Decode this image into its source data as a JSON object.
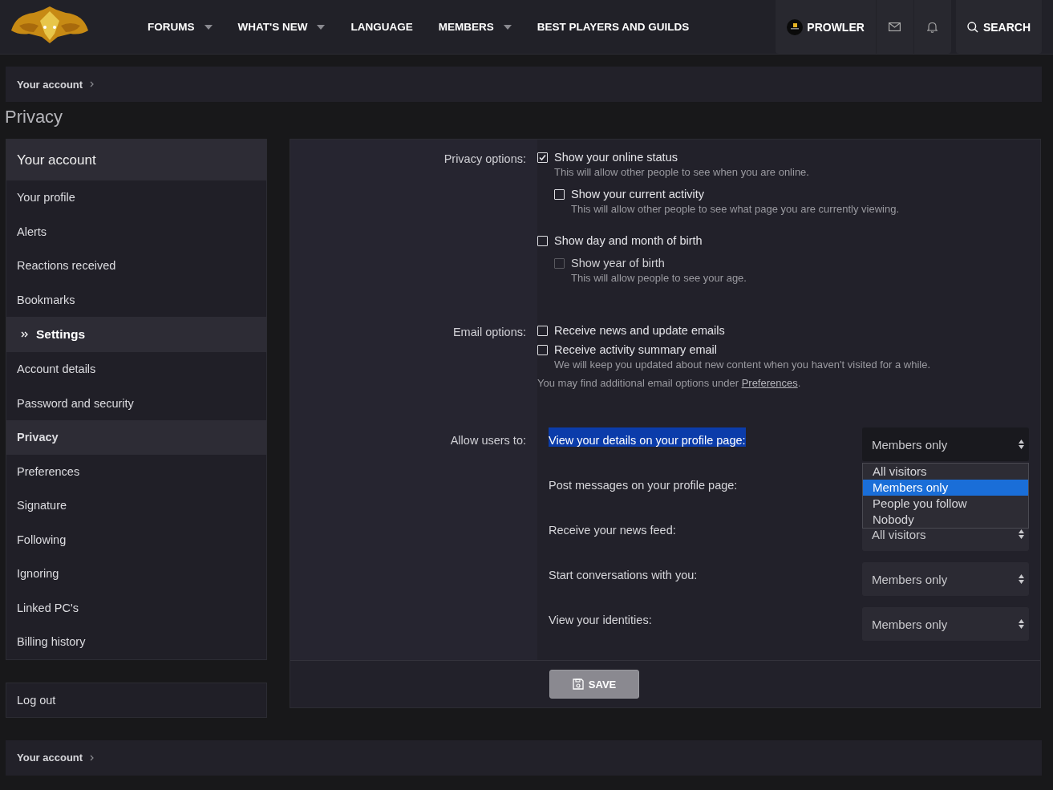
{
  "header": {
    "nav": [
      {
        "label": "FORUMS",
        "has_menu": true
      },
      {
        "label": "WHAT'S NEW",
        "has_menu": true
      },
      {
        "label": "LANGUAGE",
        "has_menu": false
      },
      {
        "label": "MEMBERS",
        "has_menu": true
      },
      {
        "label": "BEST PLAYERS AND GUILDS",
        "has_menu": false
      }
    ],
    "user": {
      "name": "PROWLER"
    },
    "search": {
      "label": "SEARCH"
    }
  },
  "breadcrumb_top": {
    "label": "Your account"
  },
  "page_title": "Privacy",
  "sidebar": {
    "heading": "Your account",
    "items": [
      {
        "label": "Your profile",
        "kind": "link",
        "selected": false
      },
      {
        "label": "Alerts",
        "kind": "link",
        "selected": false
      },
      {
        "label": "Reactions received",
        "kind": "link",
        "selected": false
      },
      {
        "label": "Bookmarks",
        "kind": "link",
        "selected": false
      },
      {
        "label": "Settings",
        "kind": "section",
        "selected": false
      },
      {
        "label": "Account details",
        "kind": "link",
        "selected": false
      },
      {
        "label": "Password and security",
        "kind": "link",
        "selected": false
      },
      {
        "label": "Privacy",
        "kind": "link",
        "selected": true
      },
      {
        "label": "Preferences",
        "kind": "link",
        "selected": false
      },
      {
        "label": "Signature",
        "kind": "link",
        "selected": false
      },
      {
        "label": "Following",
        "kind": "link",
        "selected": false
      },
      {
        "label": "Ignoring",
        "kind": "link",
        "selected": false
      },
      {
        "label": "Linked PC's",
        "kind": "link",
        "selected": false
      },
      {
        "label": "Billing history",
        "kind": "link",
        "selected": false
      }
    ],
    "logout": "Log out"
  },
  "form": {
    "groups": [
      {
        "label": "Privacy options:",
        "options": [
          {
            "label": "Show your online status",
            "checked": true,
            "disabled": false,
            "hint": "This will allow other people to see when you are online.",
            "children": [
              {
                "label": "Show your current activity",
                "checked": false,
                "disabled": false,
                "hint": "This will allow other people to see what page you are currently viewing."
              }
            ]
          },
          {
            "label": "Show day and month of birth",
            "checked": false,
            "disabled": false,
            "children": [
              {
                "label": "Show year of birth",
                "checked": false,
                "disabled": true,
                "hint": "This will allow people to see your age."
              }
            ]
          }
        ]
      },
      {
        "label": "Email options:",
        "options": [
          {
            "label": "Receive news and update emails",
            "checked": false,
            "disabled": false
          },
          {
            "label": "Receive activity summary email",
            "checked": false,
            "disabled": false,
            "hint": "We will keep you updated about new content when you haven't visited for a while."
          }
        ],
        "note": {
          "text": "You may find additional email options under ",
          "link": "Preferences",
          "after": "."
        }
      }
    ],
    "allow": {
      "label": "Allow users to:",
      "rows": [
        {
          "label": "View your details on your profile page:",
          "highlighted": true,
          "value": "Members only",
          "options": [
            {
              "label": "All visitors",
              "selected": false
            },
            {
              "label": "Members only",
              "selected": true
            },
            {
              "label": "People you follow",
              "selected": false
            },
            {
              "label": "Nobody",
              "selected": false
            }
          ]
        },
        {
          "label": "Post messages on your profile page:",
          "highlighted": false
        },
        {
          "label": "Receive your news feed:",
          "highlighted": false,
          "value": "All visitors"
        },
        {
          "label": "Start conversations with you:",
          "highlighted": false,
          "value": "Members only"
        },
        {
          "label": "View your identities:",
          "highlighted": false,
          "value": "Members only"
        }
      ]
    },
    "save": "SAVE"
  },
  "breadcrumb_bottom": {
    "label": "Your account"
  }
}
